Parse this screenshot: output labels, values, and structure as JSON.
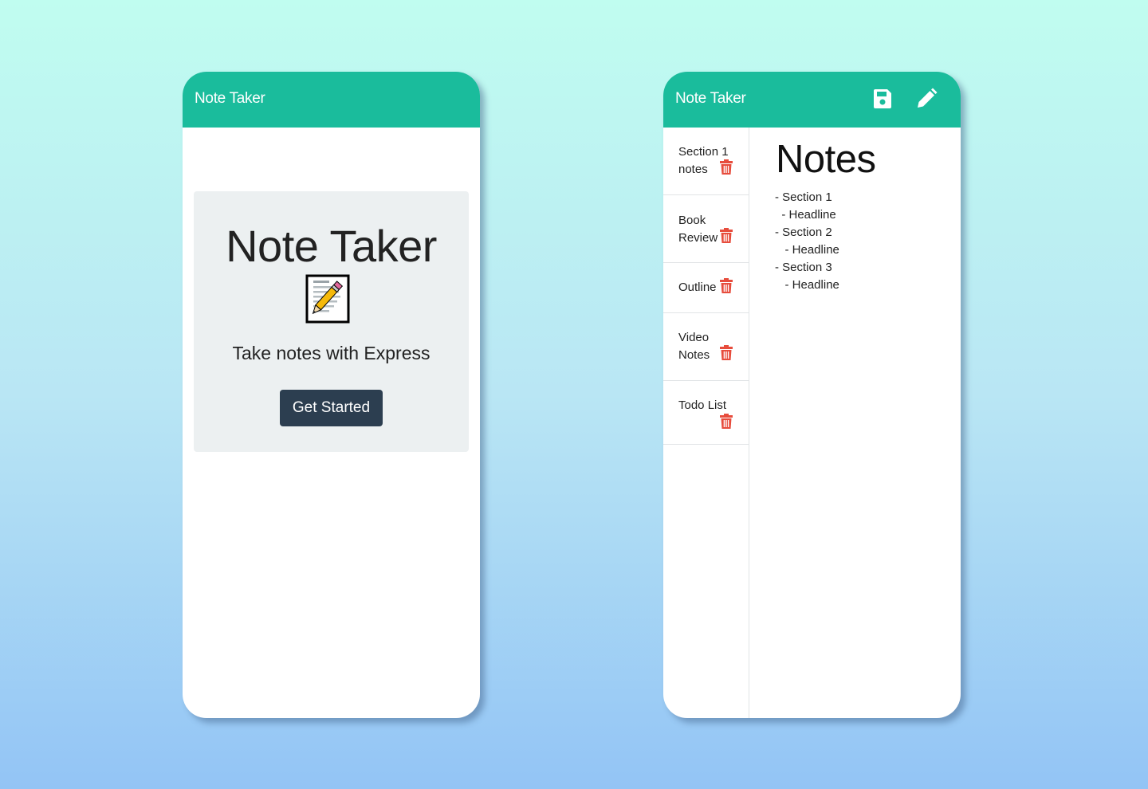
{
  "landing": {
    "brand": "Note Taker",
    "title": "Note Taker",
    "emoji_name": "memo-icon",
    "lead": "Take notes with Express",
    "cta_label": "Get Started"
  },
  "notes_app": {
    "brand": "Note Taker",
    "icons": {
      "save": "save-icon",
      "edit": "pencil-icon",
      "delete": "trash-icon"
    },
    "notes": [
      {
        "title": "Section 1 notes"
      },
      {
        "title": "Book Review"
      },
      {
        "title": "Outline"
      },
      {
        "title": "Video Notes"
      },
      {
        "title": "Todo List"
      }
    ],
    "active_note": {
      "title": "Notes",
      "body_lines": [
        "- Section 1",
        "  - Headline",
        "- Section 2",
        "   - Headline",
        "- Section 3",
        "   - Headline"
      ]
    }
  },
  "colors": {
    "navbar": "#1abc9c",
    "button": "#2c3e50",
    "jumbotron": "#ecf0f1",
    "trash": "#e74c3c"
  }
}
